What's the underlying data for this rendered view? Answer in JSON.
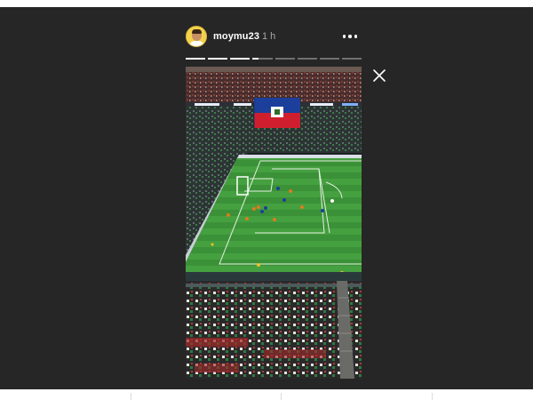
{
  "story": {
    "username": "moymu23",
    "time_ago": "1 h",
    "progress": {
      "segments_total": 8,
      "segments_completed": 3,
      "current_segment_fraction": 0.3
    }
  },
  "icons": {
    "more": "more-options-icon",
    "close": "close-icon"
  },
  "colors": {
    "viewer_background": "#262626",
    "username": "#ffffff",
    "timestamp": "#a8a8a8",
    "pitch_green": "#3f9a3b",
    "flag_blue": "#1b3f9a",
    "flag_red": "#cf1f2e"
  }
}
